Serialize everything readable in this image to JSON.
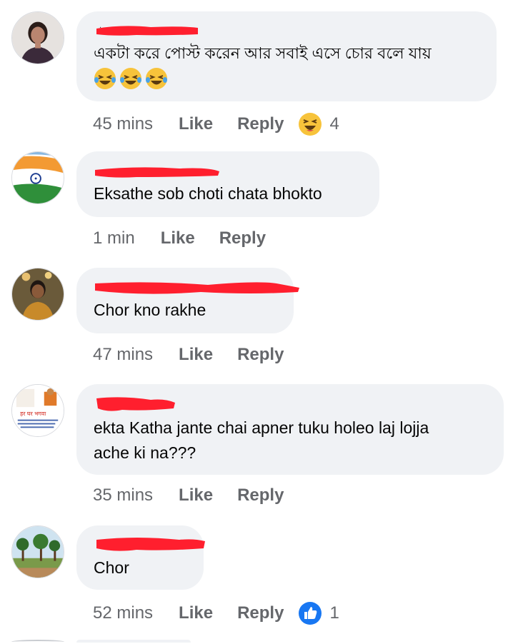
{
  "comments": [
    {
      "text": "একটা করে পোস্ট করেন আর সবাই এসে চোর বলে যায়",
      "emojis": [
        "laughing-tears-emoji",
        "laughing-tears-emoji",
        "laughing-tears-emoji"
      ],
      "time": "45 mins",
      "like": "Like",
      "reply": "Reply",
      "reaction": "haha-reaction-icon",
      "reaction_count": "4"
    },
    {
      "text": "Eksathe sob choti chata bhokto",
      "time": "1 min",
      "like": "Like",
      "reply": "Reply"
    },
    {
      "text": "Chor kno rakhe",
      "time": "47 mins",
      "like": "Like",
      "reply": "Reply"
    },
    {
      "text_line1": "ekta Katha jante chai apner tuku holeo laj lojja",
      "text_line2": "ache ki na???",
      "avatar_text": "हर घर भगवा",
      "time": "35 mins",
      "like": "Like",
      "reply": "Reply"
    },
    {
      "text": "Chor",
      "time": "52 mins",
      "like": "Like",
      "reply": "Reply",
      "reaction": "like-reaction-icon",
      "reaction_count": "1"
    }
  ],
  "colors": {
    "bubble": "#f0f2f5",
    "meta": "#65676b",
    "redact": "#ff1f2e",
    "like_blue": "#1877f2",
    "haha_yellow": "#f7c33b"
  }
}
